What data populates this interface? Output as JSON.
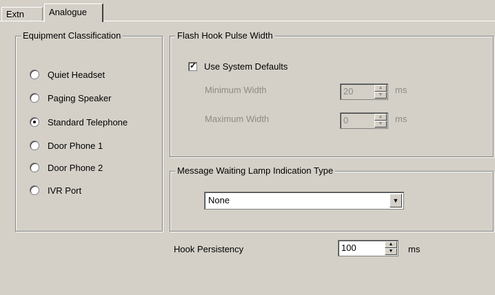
{
  "tabs": [
    {
      "label": "Extn"
    },
    {
      "label": "Analogue"
    }
  ],
  "equipment_classification": {
    "legend": "Equipment Classification",
    "options": [
      {
        "label": "Quiet Headset",
        "checked": false
      },
      {
        "label": "Paging Speaker",
        "checked": false
      },
      {
        "label": "Standard Telephone",
        "checked": true
      },
      {
        "label": "Door Phone 1",
        "checked": false
      },
      {
        "label": "Door Phone 2",
        "checked": false
      },
      {
        "label": "IVR Port",
        "checked": false
      }
    ]
  },
  "flash_hook": {
    "legend": "Flash Hook Pulse Width",
    "use_defaults_label": "Use System Defaults",
    "use_defaults_checked": true,
    "minimum_label": "Minimum Width",
    "minimum_value": "20",
    "minimum_unit": "ms",
    "maximum_label": "Maximum Width",
    "maximum_value": "0",
    "maximum_unit": "ms"
  },
  "message_waiting": {
    "legend": "Message Waiting Lamp Indication Type",
    "selected": "None"
  },
  "hook_persistency": {
    "label": "Hook Persistency",
    "value": "100",
    "unit": "ms"
  }
}
